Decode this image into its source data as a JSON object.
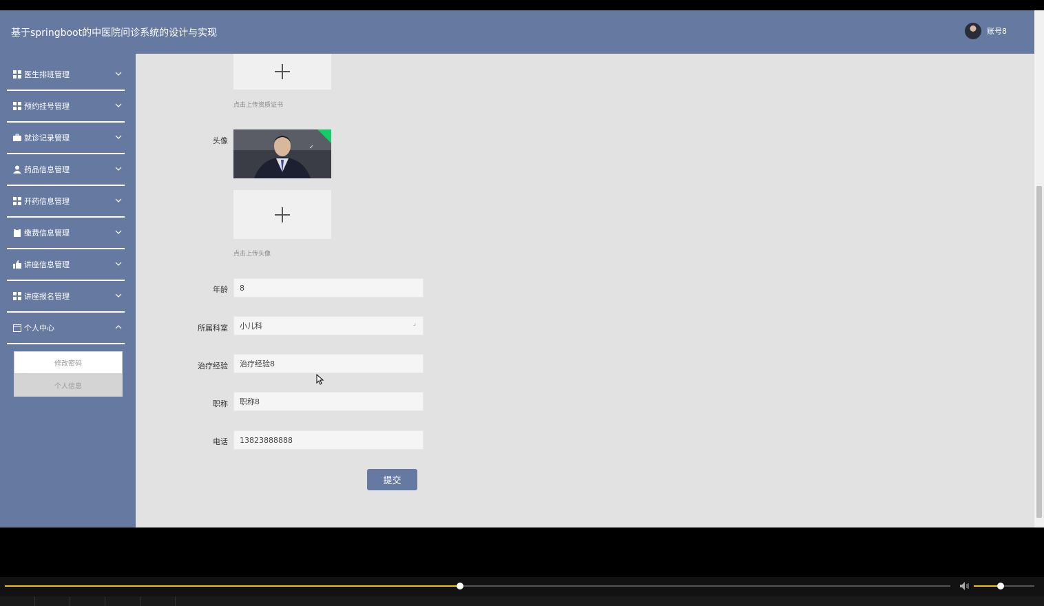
{
  "header": {
    "title": "基于springboot的中医院问诊系统的设计与实现",
    "username": "账号8"
  },
  "sidebar": {
    "items": [
      {
        "label": "医生排班管理",
        "icon": "grid-icon"
      },
      {
        "label": "预约挂号管理",
        "icon": "grid-icon"
      },
      {
        "label": "就诊记录管理",
        "icon": "briefcase-icon"
      },
      {
        "label": "药品信息管理",
        "icon": "user-icon"
      },
      {
        "label": "开药信息管理",
        "icon": "grid-icon"
      },
      {
        "label": "缴费信息管理",
        "icon": "clipboard-icon"
      },
      {
        "label": "讲座信息管理",
        "icon": "thumb-icon"
      },
      {
        "label": "讲座报名管理",
        "icon": "grid-icon"
      },
      {
        "label": "个人中心",
        "icon": "calendar-icon"
      }
    ],
    "submenu": [
      "修改密码",
      "个人信息"
    ]
  },
  "form": {
    "certificate_hint": "点击上传资质证书",
    "avatar_label": "头像",
    "avatar_hint": "点击上传头像",
    "age_label": "年龄",
    "age_value": "8",
    "department_label": "所属科室",
    "department_value": "小儿科",
    "experience_label": "治疗经验",
    "experience_value": "治疗经验8",
    "title_label": "职称",
    "title_value": "职称8",
    "phone_label": "电话",
    "phone_value": "13823888888",
    "submit_label": "提交"
  },
  "player": {
    "progress": 0.48,
    "volume": 0.44
  },
  "colors": {
    "accent": "#6679a0",
    "success": "#13ce66",
    "progress": "#f5c400"
  }
}
